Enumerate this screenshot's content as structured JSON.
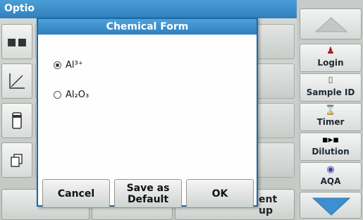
{
  "background": {
    "header_title": "Optio",
    "bottom_right_button_label": "ent\nup"
  },
  "dialog": {
    "title": "Chemical Form",
    "options": [
      {
        "label": "Al³⁺",
        "selected": true
      },
      {
        "label": "Al₂O₃",
        "selected": false
      }
    ],
    "buttons": {
      "cancel": "Cancel",
      "save_default": "Save as\nDefault",
      "ok": "OK"
    }
  },
  "sidebar": {
    "items": [
      {
        "label": "Login",
        "icon": "person-icon"
      },
      {
        "label": "Sample ID",
        "icon": "vial-icon"
      },
      {
        "label": "Timer",
        "icon": "timer-icon"
      },
      {
        "label": "Dilution",
        "icon": "dilution-icon"
      },
      {
        "label": "AQA",
        "icon": "aqa-icon"
      }
    ]
  },
  "colors": {
    "accent_blue": "#2f7fbe",
    "dialog_border": "#1c6aa8",
    "arrow_fill": "#3d8fd0"
  }
}
